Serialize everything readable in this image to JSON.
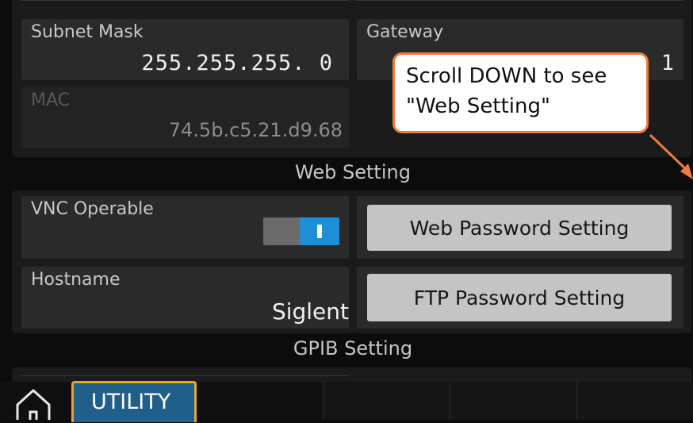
{
  "network": {
    "subnet_mask_label": "Subnet Mask",
    "subnet_mask_value": "255.255.255. 0",
    "gateway_label": "Gateway",
    "gateway_value_tail": "1",
    "mac_label": "MAC",
    "mac_value": "74.5b.c5.21.d9.68"
  },
  "callout": {
    "line1": "Scroll DOWN to see",
    "line2": "\"Web Setting\""
  },
  "web_setting": {
    "title": "Web Setting",
    "vnc_label": "VNC Operable",
    "vnc_enabled": true,
    "web_password_button": "Web Password Setting",
    "hostname_label": "Hostname",
    "hostname_value": "Siglent",
    "ftp_password_button": "FTP Password Setting"
  },
  "gpib_setting": {
    "title": "GPIB Setting"
  },
  "bottom_bar": {
    "home_icon": "home-icon",
    "active_tab": "UTILITY"
  },
  "colors": {
    "accent_orange": "#ee7b3a",
    "toggle_blue": "#1c8fd6",
    "tab_gold": "#e8a52a"
  }
}
